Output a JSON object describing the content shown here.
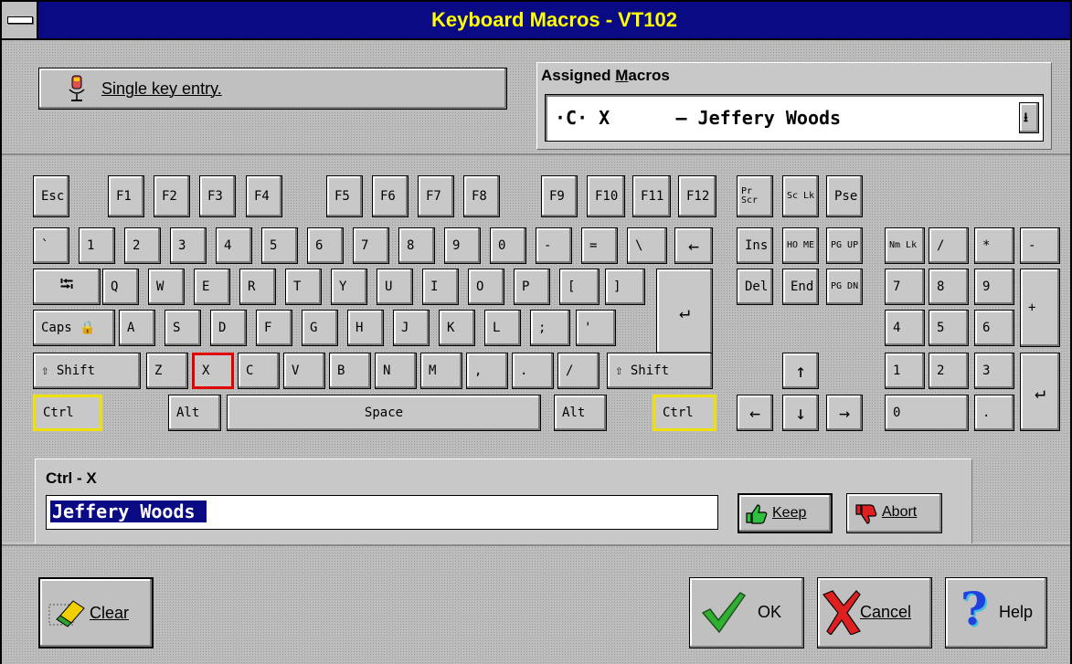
{
  "window": {
    "title": "Keyboard Macros - VT102"
  },
  "single_key_button": {
    "label": "Single key entry."
  },
  "assigned_macros": {
    "label_prefix": "Assigned ",
    "label_underlined": "M",
    "label_suffix": "acros",
    "selected_value": "·C· X      — Jeffery Woods"
  },
  "keyboard": {
    "function_row": [
      "Esc",
      "F1",
      "F2",
      "F3",
      "F4",
      "F5",
      "F6",
      "F7",
      "F8",
      "F9",
      "F10",
      "F11",
      "F12"
    ],
    "sys_keys": [
      "Pr Scr",
      "Sc Lk",
      "Pse"
    ],
    "number_row": [
      "`",
      "1",
      "2",
      "3",
      "4",
      "5",
      "6",
      "7",
      "8",
      "9",
      "0",
      "-",
      "=",
      "\\",
      "←"
    ],
    "qwerty_row": [
      "⭾",
      "Q",
      "W",
      "E",
      "R",
      "T",
      "Y",
      "U",
      "I",
      "O",
      "P",
      "[",
      "]",
      "↵"
    ],
    "home_row": [
      "Caps 🔒",
      "A",
      "S",
      "D",
      "F",
      "G",
      "H",
      "J",
      "K",
      "L",
      ";",
      "'"
    ],
    "shift_row": [
      "⇧ Shift",
      "Z",
      "X",
      "C",
      "V",
      "B",
      "N",
      "M",
      ",",
      ".",
      "/",
      "⇧ Shift"
    ],
    "bottom_row": [
      "Ctrl",
      "Alt",
      "Space",
      "Alt",
      "Ctrl"
    ],
    "nav_keys": [
      "Ins",
      "HO ME",
      "PG UP",
      "Del",
      "End",
      "PG DN"
    ],
    "arrow_keys": [
      "↑",
      "←",
      "↓",
      "→"
    ],
    "numpad": [
      "Nm Lk",
      "/",
      "*",
      "-",
      "7",
      "8",
      "9",
      "+",
      "4",
      "5",
      "6",
      "1",
      "2",
      "3",
      "↵",
      "0",
      "."
    ],
    "selected_key": "X",
    "active_modifiers": [
      "Ctrl"
    ]
  },
  "macro_editor": {
    "label": "Ctrl - X",
    "value": "Jeffery Woods",
    "keep_label": "Keep",
    "abort_label": "Abort"
  },
  "buttons": {
    "clear": "Clear",
    "ok": "OK",
    "cancel": "Cancel",
    "help": "Help"
  },
  "colors": {
    "title_bar": "#0a0a84",
    "title_text": "#ffff00",
    "modifier_highlight": "#f0e000",
    "selected_key_border": "#e00000",
    "selected_text_bg": "#0a0a84"
  }
}
